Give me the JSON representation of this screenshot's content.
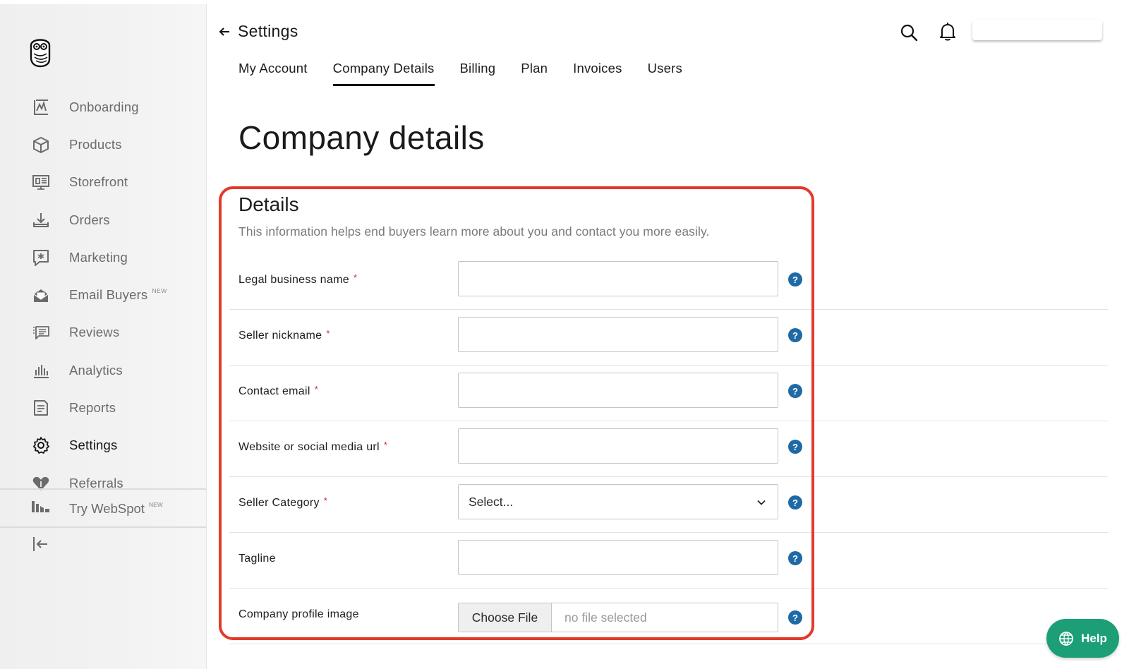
{
  "header": {
    "title": "Settings",
    "tabs": [
      {
        "label": "My Account"
      },
      {
        "label": "Company Details",
        "active": true
      },
      {
        "label": "Billing"
      },
      {
        "label": "Plan"
      },
      {
        "label": "Invoices"
      },
      {
        "label": "Users"
      }
    ]
  },
  "sidebar": {
    "items": [
      {
        "label": "Onboarding",
        "icon": "onboarding-icon"
      },
      {
        "label": "Products",
        "icon": "box-icon"
      },
      {
        "label": "Storefront",
        "icon": "storefront-icon"
      },
      {
        "label": "Orders",
        "icon": "download-tray-icon"
      },
      {
        "label": "Marketing",
        "icon": "marketing-icon"
      },
      {
        "label": "Email Buyers",
        "badge": "NEW",
        "icon": "envelope-icon"
      },
      {
        "label": "Reviews",
        "icon": "reviews-icon"
      },
      {
        "label": "Analytics",
        "icon": "bar-chart-icon"
      },
      {
        "label": "Reports",
        "icon": "report-icon"
      },
      {
        "label": "Settings",
        "icon": "gear-icon",
        "active": true
      },
      {
        "label": "Referrals",
        "icon": "heart-tag-icon"
      }
    ],
    "try_webspot": {
      "label": "Try WebSpot",
      "badge": "NEW"
    }
  },
  "page": {
    "title": "Company details",
    "section_title": "Details",
    "section_desc": "This information helps end buyers learn more about you and contact you more easily."
  },
  "form": {
    "fields": [
      {
        "label": "Legal business name",
        "required": "*",
        "type": "text",
        "value": ""
      },
      {
        "label": "Seller nickname",
        "required": "*",
        "type": "text",
        "value": ""
      },
      {
        "label": "Contact email",
        "required": "*",
        "type": "text",
        "value": ""
      },
      {
        "label": "Website or social media url",
        "required": "*",
        "type": "text",
        "value": ""
      },
      {
        "label": "Seller Category",
        "required": "*",
        "type": "select",
        "value": "Select..."
      },
      {
        "label": "Tagline",
        "required": "",
        "type": "text",
        "value": ""
      },
      {
        "label": "Company profile image",
        "required": "",
        "type": "file",
        "button": "Choose File",
        "status": "no file selected"
      }
    ],
    "help_glyph": "?"
  },
  "help_button": {
    "label": "Help"
  },
  "colors": {
    "accent_green": "#1c9e76",
    "help_blue": "#1f6aa5",
    "required_red": "#d8262d",
    "highlight_red": "#e23a2a"
  }
}
